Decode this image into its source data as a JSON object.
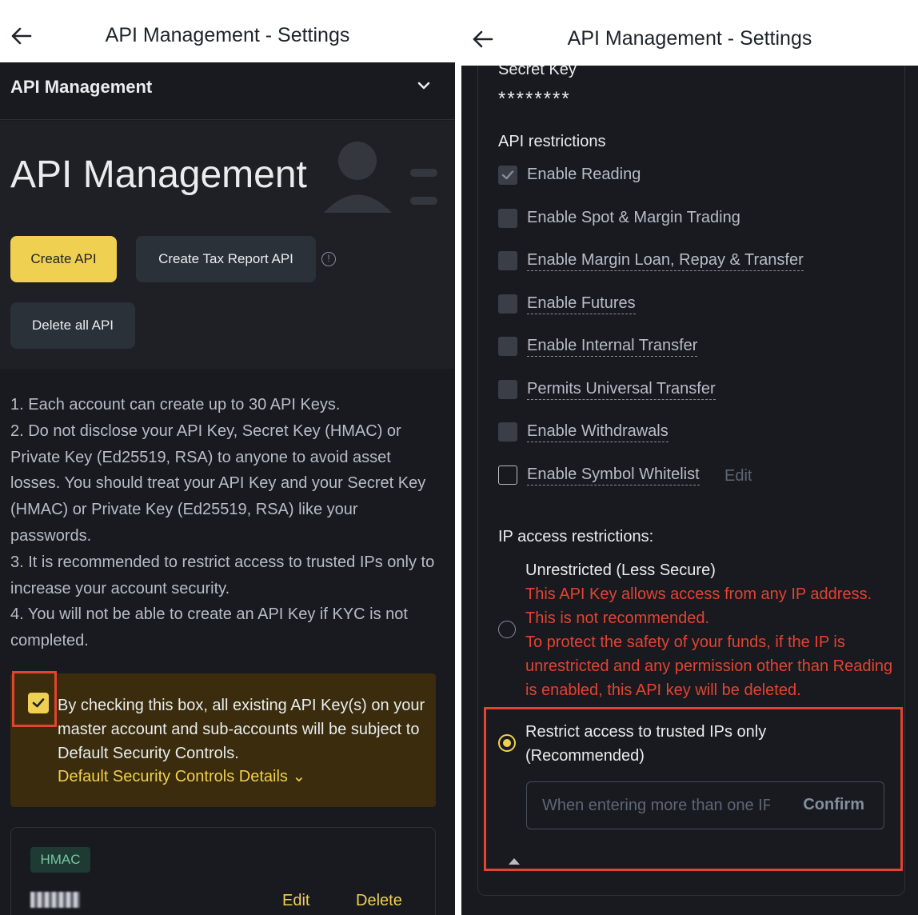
{
  "left": {
    "header": {
      "title": "API Management - Settings",
      "back_icon": "arrow-left-icon"
    },
    "section": {
      "label": "API Management"
    },
    "hero": {
      "title": "API Management"
    },
    "buttons": {
      "create": "Create API",
      "tax": "Create Tax Report API",
      "delete_all": "Delete all API",
      "info_icon": "!"
    },
    "notes": [
      "1. Each account can create up to 30 API Keys.",
      "2. Do not disclose your API Key, Secret Key (HMAC) or Private Key (Ed25519, RSA) to anyone to avoid asset losses. You should treat your API Key and your Secret Key (HMAC) or Private Key (Ed25519, RSA) like your passwords.",
      "3. It is recommended to restrict access to trusted IPs only to increase your account security.",
      "4. You will not be able to create an API Key if KYC is not completed."
    ],
    "consent": {
      "checked": true,
      "text": "By checking this box, all existing API Key(s) on your master account and sub-accounts will be subject to Default Security Controls.",
      "link": "Default Security Controls Details ⌄"
    },
    "api_card": {
      "tag": "HMAC",
      "edit": "Edit",
      "delete": "Delete"
    }
  },
  "right": {
    "header": {
      "title": "API Management - Settings",
      "back_icon": "arrow-left-icon"
    },
    "secret_key": {
      "label": "Secret Key",
      "value": "********"
    },
    "restrictions_label": "API restrictions",
    "permissions": [
      {
        "label": "Enable Reading",
        "checked": true
      },
      {
        "label": "Enable Spot & Margin Trading",
        "checked": false
      },
      {
        "label": "Enable Margin Loan, Repay & Transfer",
        "checked": false
      },
      {
        "label": "Enable Futures",
        "checked": false
      },
      {
        "label": "Enable Internal Transfer",
        "checked": false
      },
      {
        "label": "Permits Universal Transfer",
        "checked": false
      },
      {
        "label": "Enable Withdrawals",
        "checked": false
      },
      {
        "label": "Enable Symbol Whitelist",
        "checked": false,
        "edit": "Edit"
      }
    ],
    "ip": {
      "label": "IP access restrictions:",
      "unrestricted": {
        "title": "Unrestricted (Less Secure)",
        "warning_1": "This API Key allows access from any IP address. This is not recommended.",
        "warning_2": "To protect the safety of your funds, if the IP is unrestricted and any permission other than Reading is enabled, this API key will be deleted."
      },
      "restricted": {
        "title_1": "Restrict access to trusted IPs only",
        "title_2": "(Recommended)",
        "placeholder": "When entering more than one IP",
        "confirm": "Confirm"
      }
    },
    "colors": {
      "accent": "#f0d050",
      "danger": "#e2442f",
      "background": "#181a20"
    }
  }
}
